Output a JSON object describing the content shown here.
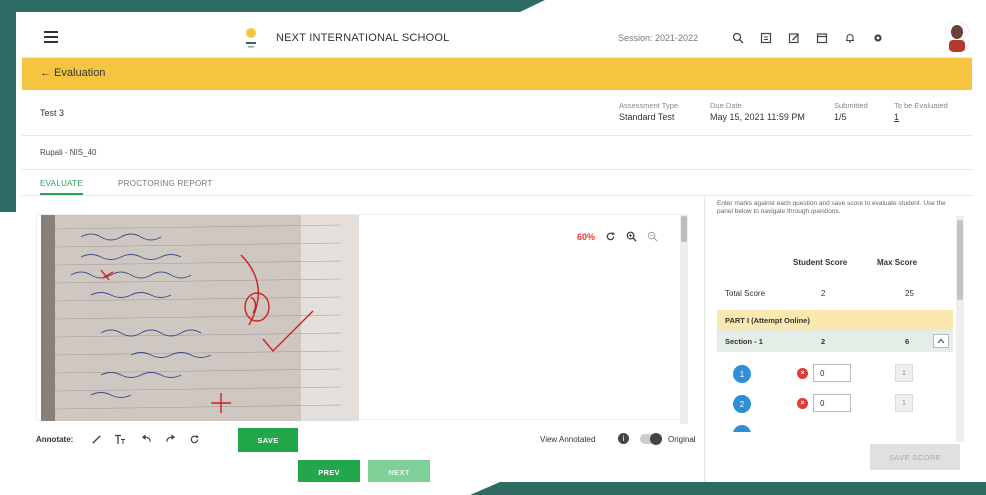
{
  "header": {
    "school_name": "NEXT INTERNATIONAL SCHOOL",
    "session": "Session: 2021-2022",
    "icons": [
      "search-icon",
      "clipboard-icon",
      "edit-icon",
      "calendar-icon",
      "bell-icon",
      "gear-icon"
    ]
  },
  "evaluation": {
    "back_label": "← Evaluation"
  },
  "test": {
    "name": "Test 3",
    "assessment_type_label": "Assessment Type",
    "assessment_type": "Standard Test",
    "due_date_label": "Due Date",
    "due_date": "May 15, 2021 11:59 PM",
    "submitted_label": "Submitted",
    "submitted": "1/5",
    "to_be_evaluated_label": "To be Evaluated",
    "to_be_evaluated": "1"
  },
  "student": {
    "name": "Rupali - NIS_40"
  },
  "tabs": [
    {
      "label": "EVALUATE",
      "active": true
    },
    {
      "label": "PROCTORING REPORT",
      "active": false
    }
  ],
  "viewer": {
    "zoom": "60%"
  },
  "annotate": {
    "label": "Annotate:",
    "save_label": "SAVE",
    "view_annotated": "View Annotated",
    "original": "Original"
  },
  "navigation": {
    "prev_label": "PREV",
    "next_label": "NEXT"
  },
  "panel": {
    "intro": "Enter marks against each question and save score to evaluate student. Use the panel below to navigate through questions.",
    "student_score_header": "Student Score",
    "max_score_header": "Max Score",
    "total_label": "Total Score",
    "total_student": "2",
    "total_max": "25",
    "part_label": "PART I (Attempt Online)",
    "section_label": "Section - 1",
    "section_student": "2",
    "section_max": "6",
    "questions": [
      {
        "num": "1",
        "score": "0",
        "max": "1"
      },
      {
        "num": "2",
        "score": "0",
        "max": "1"
      }
    ],
    "save_score_label": "SAVE SCORE"
  },
  "colors": {
    "accent_yellow": "#f5c542",
    "accent_green": "#22a84b",
    "frame_teal": "#2e6b64"
  }
}
